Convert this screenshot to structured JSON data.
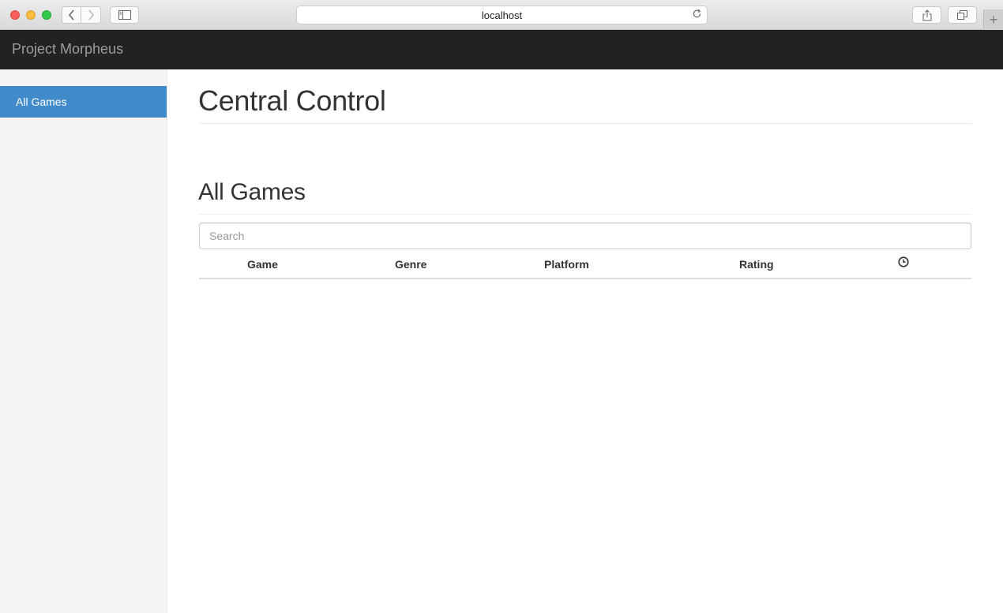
{
  "browser": {
    "url": "localhost",
    "icons": [
      "back-arrow-icon",
      "forward-arrow-icon",
      "sidebar-icon",
      "reload-icon",
      "share-icon",
      "tabs-icon",
      "plus-icon"
    ]
  },
  "navbar": {
    "brand": "Project Morpheus"
  },
  "sidebar": {
    "items": [
      {
        "label": "All Games",
        "active": true
      }
    ]
  },
  "main": {
    "page_title": "Central Control",
    "section_title": "All Games",
    "search": {
      "placeholder": "Search",
      "value": ""
    },
    "table": {
      "columns": [
        "Game",
        "Genre",
        "Platform",
        "Rating"
      ],
      "last_column_icon": "clock-icon",
      "rows": []
    }
  },
  "colors": {
    "navbar_bg": "#222222",
    "active_item": "#428bca",
    "sidebar_bg": "#f5f5f5"
  }
}
